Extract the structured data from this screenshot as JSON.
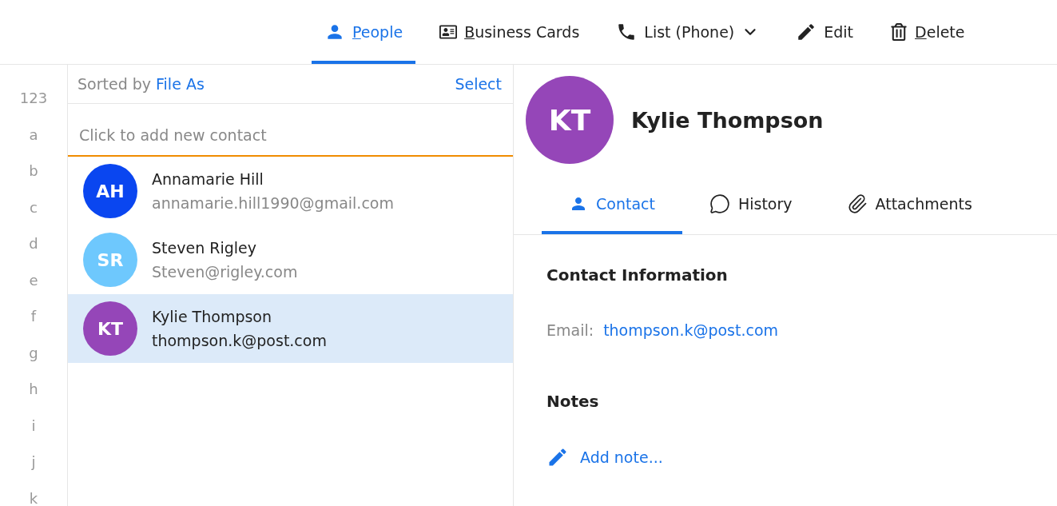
{
  "toolbar": [
    {
      "kind": "tab",
      "label": "People",
      "accesskey": true,
      "selected": true
    },
    {
      "kind": "button",
      "label": "Business Cards",
      "accesskey": true
    },
    {
      "kind": "dropdown",
      "label": "List (Phone)",
      "accesskey": false
    },
    {
      "kind": "button",
      "label": "Edit",
      "accesskey": false
    },
    {
      "kind": "button",
      "label": "Delete",
      "accesskey": true
    }
  ],
  "index": [
    "123",
    "a",
    "b",
    "c",
    "d",
    "e",
    "f",
    "g",
    "h",
    "i",
    "j",
    "k"
  ],
  "list_header": {
    "sorted_label": "Sorted by",
    "sort_field": "File As",
    "select": "Select"
  },
  "new_contact": {
    "placeholder": "Click to add new contact"
  },
  "contacts": [
    {
      "initials": "AH",
      "name": "Annamarie Hill",
      "email": "annamarie.hill1990@gmail.com",
      "color": "#0a46f0",
      "selected": false
    },
    {
      "initials": "SR",
      "name": "Steven Rigley",
      "email": "Steven@rigley.com",
      "color": "#6ec8fd",
      "selected": false
    },
    {
      "initials": "KT",
      "name": "Kylie Thompson",
      "email": "thompson.k@post.com",
      "color": "#9546b8",
      "selected": true
    }
  ],
  "detail": {
    "initials": "KT",
    "name": "Kylie Thompson",
    "color": "#9546b8",
    "tabs": [
      {
        "kind": "contact",
        "label": "Contact",
        "selected": true
      },
      {
        "kind": "history",
        "label": "History",
        "selected": false
      },
      {
        "kind": "attachments",
        "label": "Attachments",
        "selected": false
      }
    ],
    "section_title": "Contact Information",
    "email_label": "Email:",
    "email": "thompson.k@post.com",
    "notes_title": "Notes",
    "add_note": "Add note..."
  }
}
